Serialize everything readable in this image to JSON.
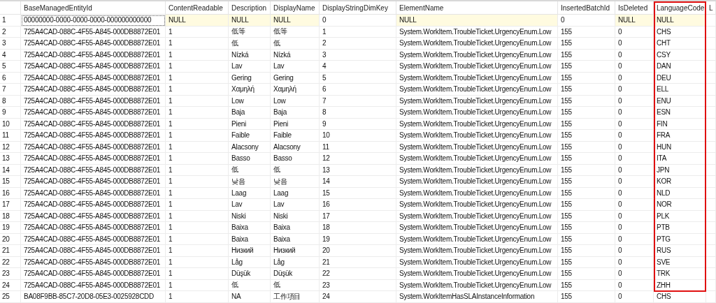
{
  "table": {
    "columns": [
      {
        "highlighted": false
      },
      {
        "label": "BaseManagedEntityId",
        "highlighted": false
      },
      {
        "label": "ContentReadable",
        "highlighted": false
      },
      {
        "label": "Description",
        "highlighted": false
      },
      {
        "label": "DisplayName",
        "highlighted": false
      },
      {
        "label": "DisplayStringDimKey",
        "highlighted": false
      },
      {
        "label": "ElementName",
        "highlighted": false
      },
      {
        "label": "InsertedBatchId",
        "highlighted": false
      },
      {
        "label": "IsDeleted",
        "highlighted": false
      },
      {
        "label": "LanguageCode",
        "highlighted": true
      },
      {
        "label": "L",
        "highlighted": false
      }
    ],
    "rows": [
      {
        "focused": true,
        "cells": [
          {
            "text": "1",
            "is_null": false
          },
          {
            "text": "00000000-0000-0000-0000-000000000000",
            "is_null": false
          },
          {
            "text": "NULL",
            "is_null": true
          },
          {
            "text": "NULL",
            "is_null": true
          },
          {
            "text": "NULL",
            "is_null": true
          },
          {
            "text": "0",
            "is_null": false
          },
          {
            "text": "NULL",
            "is_null": true
          },
          {
            "text": "0",
            "is_null": false
          },
          {
            "text": "NULL",
            "is_null": true
          },
          {
            "text": "NULL",
            "is_null": true
          }
        ]
      },
      {
        "focused": false,
        "cells": [
          "2",
          "725A4CAD-088C-4F55-A845-000DB8872E01",
          "1",
          "低等",
          "低等",
          "1",
          "System.WorkItem.TroubleTicket.UrgencyEnum.Low",
          "155",
          "0",
          "CHS"
        ]
      },
      {
        "focused": false,
        "cells": [
          "3",
          "725A4CAD-088C-4F55-A845-000DB8872E01",
          "1",
          "低",
          "低",
          "2",
          "System.WorkItem.TroubleTicket.UrgencyEnum.Low",
          "155",
          "0",
          "CHT"
        ]
      },
      {
        "focused": false,
        "cells": [
          "4",
          "725A4CAD-088C-4F55-A845-000DB8872E01",
          "1",
          "Nízká",
          "Nízká",
          "3",
          "System.WorkItem.TroubleTicket.UrgencyEnum.Low",
          "155",
          "0",
          "CSY"
        ]
      },
      {
        "focused": false,
        "cells": [
          "5",
          "725A4CAD-088C-4F55-A845-000DB8872E01",
          "1",
          "Lav",
          "Lav",
          "4",
          "System.WorkItem.TroubleTicket.UrgencyEnum.Low",
          "155",
          "0",
          "DAN"
        ]
      },
      {
        "focused": false,
        "cells": [
          "6",
          "725A4CAD-088C-4F55-A845-000DB8872E01",
          "1",
          "Gering",
          "Gering",
          "5",
          "System.WorkItem.TroubleTicket.UrgencyEnum.Low",
          "155",
          "0",
          "DEU"
        ]
      },
      {
        "focused": false,
        "cells": [
          "7",
          "725A4CAD-088C-4F55-A845-000DB8872E01",
          "1",
          "Χαμηλή",
          "Χαμηλή",
          "6",
          "System.WorkItem.TroubleTicket.UrgencyEnum.Low",
          "155",
          "0",
          "ELL"
        ]
      },
      {
        "focused": false,
        "cells": [
          "8",
          "725A4CAD-088C-4F55-A845-000DB8872E01",
          "1",
          "Low",
          "Low",
          "7",
          "System.WorkItem.TroubleTicket.UrgencyEnum.Low",
          "155",
          "0",
          "ENU"
        ]
      },
      {
        "focused": false,
        "cells": [
          "9",
          "725A4CAD-088C-4F55-A845-000DB8872E01",
          "1",
          "Baja",
          "Baja",
          "8",
          "System.WorkItem.TroubleTicket.UrgencyEnum.Low",
          "155",
          "0",
          "ESN"
        ]
      },
      {
        "focused": false,
        "cells": [
          "10",
          "725A4CAD-088C-4F55-A845-000DB8872E01",
          "1",
          "Pieni",
          "Pieni",
          "9",
          "System.WorkItem.TroubleTicket.UrgencyEnum.Low",
          "155",
          "0",
          "FIN"
        ]
      },
      {
        "focused": false,
        "cells": [
          "11",
          "725A4CAD-088C-4F55-A845-000DB8872E01",
          "1",
          "Faible",
          "Faible",
          "10",
          "System.WorkItem.TroubleTicket.UrgencyEnum.Low",
          "155",
          "0",
          "FRA"
        ]
      },
      {
        "focused": false,
        "cells": [
          "12",
          "725A4CAD-088C-4F55-A845-000DB8872E01",
          "1",
          "Alacsony",
          "Alacsony",
          "11",
          "System.WorkItem.TroubleTicket.UrgencyEnum.Low",
          "155",
          "0",
          "HUN"
        ]
      },
      {
        "focused": false,
        "cells": [
          "13",
          "725A4CAD-088C-4F55-A845-000DB8872E01",
          "1",
          "Basso",
          "Basso",
          "12",
          "System.WorkItem.TroubleTicket.UrgencyEnum.Low",
          "155",
          "0",
          "ITA"
        ]
      },
      {
        "focused": false,
        "cells": [
          "14",
          "725A4CAD-088C-4F55-A845-000DB8872E01",
          "1",
          "低",
          "低",
          "13",
          "System.WorkItem.TroubleTicket.UrgencyEnum.Low",
          "155",
          "0",
          "JPN"
        ]
      },
      {
        "focused": false,
        "cells": [
          "15",
          "725A4CAD-088C-4F55-A845-000DB8872E01",
          "1",
          "낮음",
          "낮음",
          "14",
          "System.WorkItem.TroubleTicket.UrgencyEnum.Low",
          "155",
          "0",
          "KOR"
        ]
      },
      {
        "focused": false,
        "cells": [
          "16",
          "725A4CAD-088C-4F55-A845-000DB8872E01",
          "1",
          "Laag",
          "Laag",
          "15",
          "System.WorkItem.TroubleTicket.UrgencyEnum.Low",
          "155",
          "0",
          "NLD"
        ]
      },
      {
        "focused": false,
        "cells": [
          "17",
          "725A4CAD-088C-4F55-A845-000DB8872E01",
          "1",
          "Lav",
          "Lav",
          "16",
          "System.WorkItem.TroubleTicket.UrgencyEnum.Low",
          "155",
          "0",
          "NOR"
        ]
      },
      {
        "focused": false,
        "cells": [
          "18",
          "725A4CAD-088C-4F55-A845-000DB8872E01",
          "1",
          "Niski",
          "Niski",
          "17",
          "System.WorkItem.TroubleTicket.UrgencyEnum.Low",
          "155",
          "0",
          "PLK"
        ]
      },
      {
        "focused": false,
        "cells": [
          "19",
          "725A4CAD-088C-4F55-A845-000DB8872E01",
          "1",
          "Baixa",
          "Baixa",
          "18",
          "System.WorkItem.TroubleTicket.UrgencyEnum.Low",
          "155",
          "0",
          "PTB"
        ]
      },
      {
        "focused": false,
        "cells": [
          "20",
          "725A4CAD-088C-4F55-A845-000DB8872E01",
          "1",
          "Baixa",
          "Baixa",
          "19",
          "System.WorkItem.TroubleTicket.UrgencyEnum.Low",
          "155",
          "0",
          "PTG"
        ]
      },
      {
        "focused": false,
        "cells": [
          "21",
          "725A4CAD-088C-4F55-A845-000DB8872E01",
          "1",
          "Низкий",
          "Низкий",
          "20",
          "System.WorkItem.TroubleTicket.UrgencyEnum.Low",
          "155",
          "0",
          "RUS"
        ]
      },
      {
        "focused": false,
        "cells": [
          "22",
          "725A4CAD-088C-4F55-A845-000DB8872E01",
          "1",
          "Låg",
          "Låg",
          "21",
          "System.WorkItem.TroubleTicket.UrgencyEnum.Low",
          "155",
          "0",
          "SVE"
        ]
      },
      {
        "focused": false,
        "cells": [
          "23",
          "725A4CAD-088C-4F55-A845-000DB8872E01",
          "1",
          "Düşük",
          "Düşük",
          "22",
          "System.WorkItem.TroubleTicket.UrgencyEnum.Low",
          "155",
          "0",
          "TRK"
        ]
      },
      {
        "focused": false,
        "cells": [
          "24",
          "725A4CAD-088C-4F55-A845-000DB8872E01",
          "1",
          "低",
          "低",
          "23",
          "System.WorkItem.TroubleTicket.UrgencyEnum.Low",
          "155",
          "0",
          "ZHH"
        ]
      },
      {
        "focused": false,
        "cells": [
          "25",
          "BA08F9BB-85C7-20D8-05E3-0025928CDD",
          "1",
          "NA",
          "工作項目",
          "24",
          "System.WorkItemHasSLAInstanceInformation",
          "155",
          "0",
          "CHS"
        ]
      }
    ]
  }
}
